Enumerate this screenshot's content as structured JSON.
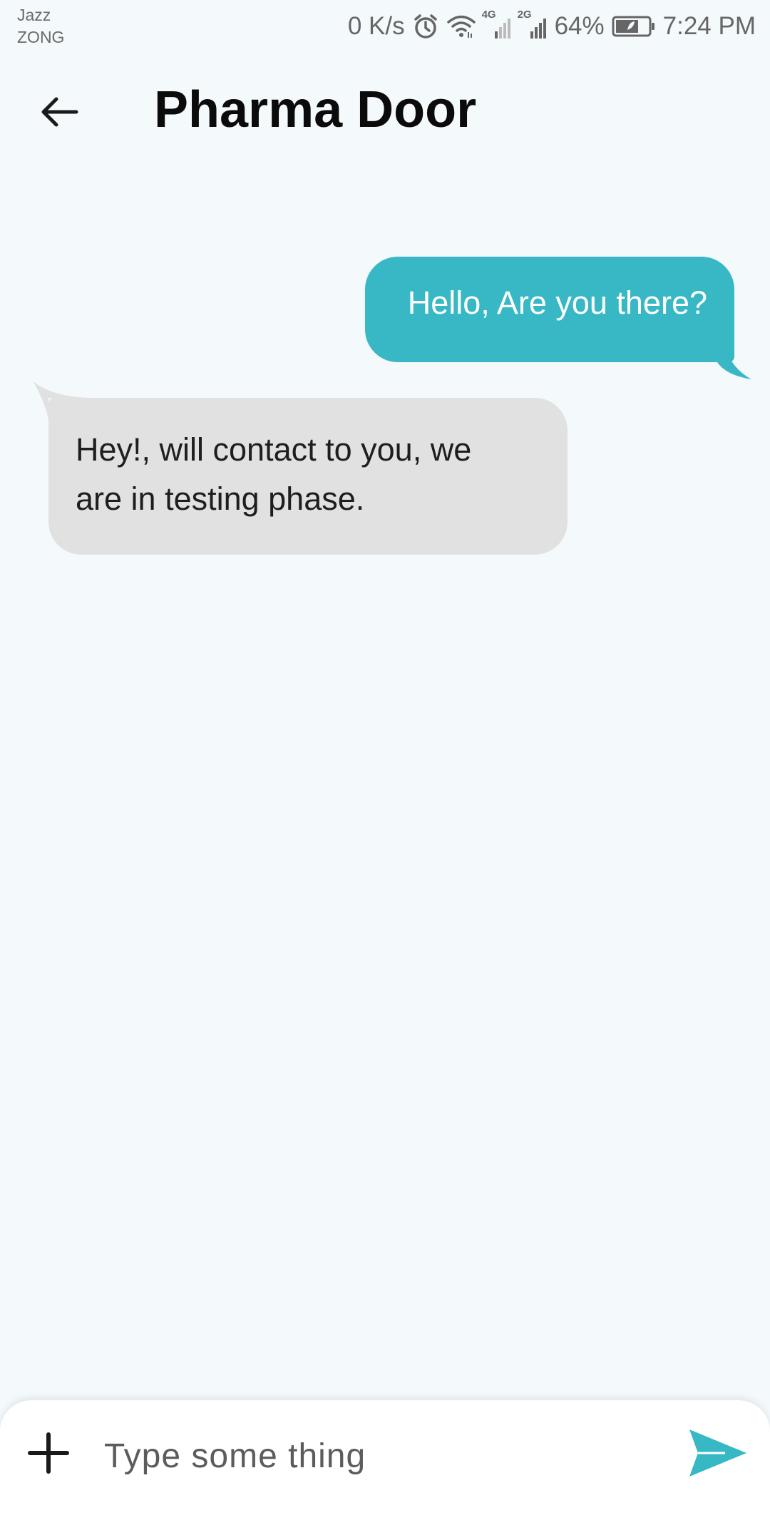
{
  "status_bar": {
    "carrier_1": "Jazz",
    "carrier_2": "ZONG",
    "network_speed": "0 K/s",
    "net_tag_1": "4G",
    "net_tag_2": "2G",
    "battery_percent": "64%",
    "time": "7:24 PM",
    "icons": [
      "alarm-icon",
      "wifi-icon",
      "signal-4g-icon",
      "signal-2g-icon",
      "battery-icon"
    ]
  },
  "app_bar": {
    "back_icon": "arrow-left-icon",
    "title": "Pharma Door"
  },
  "messages": [
    {
      "direction": "sent",
      "text": "Hello, Are you there?"
    },
    {
      "direction": "received",
      "text": "Hey!, will contact to you, we are in testing phase."
    }
  ],
  "composer": {
    "add_icon": "plus-icon",
    "placeholder": "Type some thing",
    "value": "",
    "send_icon": "send-icon"
  },
  "colors": {
    "accent": "#38b8c4",
    "sent_bubble": "#38b8c4",
    "received_bubble": "#e1e1e1",
    "background": "#f4f9fc"
  }
}
